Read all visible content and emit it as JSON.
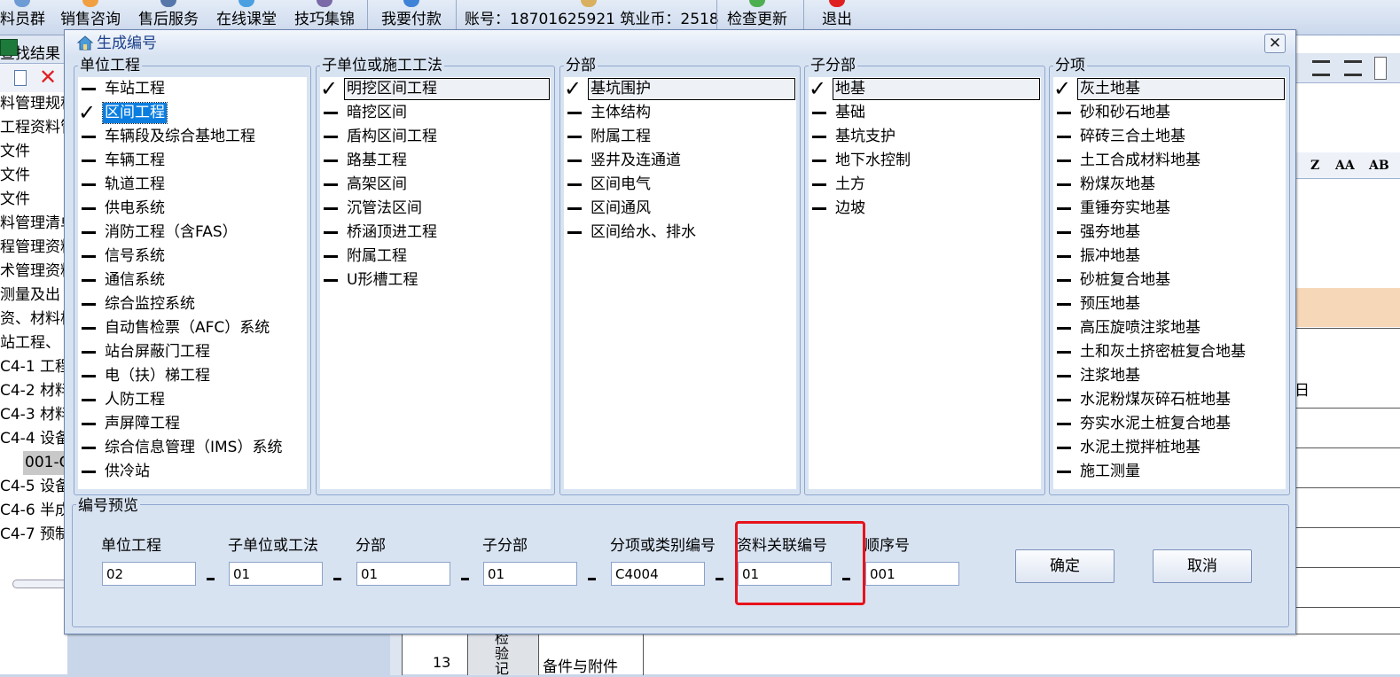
{
  "toolbar": {
    "items": [
      "料员群",
      "销售咨询",
      "售后服务",
      "在线课堂",
      "技巧集锦",
      "我要付款",
      "账号：18701625921 筑业币：2518",
      "检查更新",
      "退出"
    ]
  },
  "left_panel": {
    "header": "查找结果",
    "tree_items": [
      "料管理规程",
      "工程资料管",
      "文件",
      "文件",
      "文件",
      "料管理清单",
      "程管理资料",
      "术管理资料",
      "测量及出",
      "资、材料构",
      "站工程、",
      "C4-1 工程",
      "C4-2 材料",
      "C4-3 材料",
      "C4-4 设备",
      "001-C",
      "C4-5 设备",
      "C4-6 半成",
      "C4-7 预制"
    ]
  },
  "right_panel": {
    "fmt_buttons": [
      "Z",
      "AA",
      "AB"
    ],
    "fragment_text": "日"
  },
  "bottom_row": {
    "number": "13",
    "vertical_text": "检验记",
    "cell_text": "备件与附件"
  },
  "dialog": {
    "title": "生成编号",
    "close_glyph": "✕",
    "panels": [
      {
        "title": "单位工程",
        "items": [
          {
            "label": "车站工程",
            "mark": "dash"
          },
          {
            "label": "区间工程",
            "mark": "check",
            "selected": true
          },
          {
            "label": "车辆段及综合基地工程",
            "mark": "dash"
          },
          {
            "label": "车辆工程",
            "mark": "dash"
          },
          {
            "label": "轨道工程",
            "mark": "dash"
          },
          {
            "label": "供电系统",
            "mark": "dash"
          },
          {
            "label": "消防工程（含FAS）",
            "mark": "dash"
          },
          {
            "label": "信号系统",
            "mark": "dash"
          },
          {
            "label": "通信系统",
            "mark": "dash"
          },
          {
            "label": "综合监控系统",
            "mark": "dash"
          },
          {
            "label": "自动售检票（AFC）系统",
            "mark": "dash"
          },
          {
            "label": "站台屏蔽门工程",
            "mark": "dash"
          },
          {
            "label": "电（扶）梯工程",
            "mark": "dash"
          },
          {
            "label": "人防工程",
            "mark": "dash"
          },
          {
            "label": "声屏障工程",
            "mark": "dash"
          },
          {
            "label": "综合信息管理（IMS）系统",
            "mark": "dash"
          },
          {
            "label": "供冷站",
            "mark": "dash"
          }
        ]
      },
      {
        "title": "子单位或施工工法",
        "items": [
          {
            "label": "明挖区间工程",
            "mark": "check",
            "current": true
          },
          {
            "label": "暗挖区间",
            "mark": "dash"
          },
          {
            "label": "盾构区间工程",
            "mark": "dash"
          },
          {
            "label": "路基工程",
            "mark": "dash"
          },
          {
            "label": "高架区间",
            "mark": "dash"
          },
          {
            "label": "沉管法区间",
            "mark": "dash"
          },
          {
            "label": "桥涵顶进工程",
            "mark": "dash"
          },
          {
            "label": "附属工程",
            "mark": "dash"
          },
          {
            "label": "U形槽工程",
            "mark": "dash"
          }
        ]
      },
      {
        "title": "分部",
        "items": [
          {
            "label": "基坑围护",
            "mark": "check",
            "current": true
          },
          {
            "label": "主体结构",
            "mark": "dash"
          },
          {
            "label": "附属工程",
            "mark": "dash"
          },
          {
            "label": "竖井及连通道",
            "mark": "dash"
          },
          {
            "label": "区间电气",
            "mark": "dash"
          },
          {
            "label": "区间通风",
            "mark": "dash"
          },
          {
            "label": "区间给水、排水",
            "mark": "dash"
          }
        ]
      },
      {
        "title": "子分部",
        "items": [
          {
            "label": "地基",
            "mark": "check",
            "current": true
          },
          {
            "label": "基础",
            "mark": "dash"
          },
          {
            "label": "基坑支护",
            "mark": "dash"
          },
          {
            "label": "地下水控制",
            "mark": "dash"
          },
          {
            "label": "土方",
            "mark": "dash"
          },
          {
            "label": "边坡",
            "mark": "dash"
          }
        ]
      },
      {
        "title": "分项",
        "items": [
          {
            "label": "灰土地基",
            "mark": "check",
            "current": true
          },
          {
            "label": "砂和砂石地基",
            "mark": "dash"
          },
          {
            "label": "碎砖三合土地基",
            "mark": "dash"
          },
          {
            "label": "土工合成材料地基",
            "mark": "dash"
          },
          {
            "label": "粉煤灰地基",
            "mark": "dash"
          },
          {
            "label": "重锤夯实地基",
            "mark": "dash"
          },
          {
            "label": "强夯地基",
            "mark": "dash"
          },
          {
            "label": "振冲地基",
            "mark": "dash"
          },
          {
            "label": "砂桩复合地基",
            "mark": "dash"
          },
          {
            "label": "预压地基",
            "mark": "dash"
          },
          {
            "label": "高压旋喷注浆地基",
            "mark": "dash"
          },
          {
            "label": "土和灰土挤密桩复合地基",
            "mark": "dash"
          },
          {
            "label": "注浆地基",
            "mark": "dash"
          },
          {
            "label": "水泥粉煤灰碎石桩地基",
            "mark": "dash"
          },
          {
            "label": "夯实水泥土桩复合地基",
            "mark": "dash"
          },
          {
            "label": "水泥土搅拌桩地基",
            "mark": "dash"
          },
          {
            "label": "施工测量",
            "mark": "dash"
          }
        ]
      }
    ],
    "preview": {
      "title": "编号预览",
      "fields": [
        {
          "label": "单位工程",
          "value": "02"
        },
        {
          "label": "子单位或工法",
          "value": "01"
        },
        {
          "label": "分部",
          "value": "01"
        },
        {
          "label": "子分部",
          "value": "01"
        },
        {
          "label": "分项或类别编号",
          "value": "C4004"
        },
        {
          "label": "资料关联编号",
          "value": "01"
        },
        {
          "label": "顺序号",
          "value": "001"
        }
      ],
      "ok_label": "确定",
      "cancel_label": "取消",
      "highlight_color": "#e8121b"
    }
  }
}
